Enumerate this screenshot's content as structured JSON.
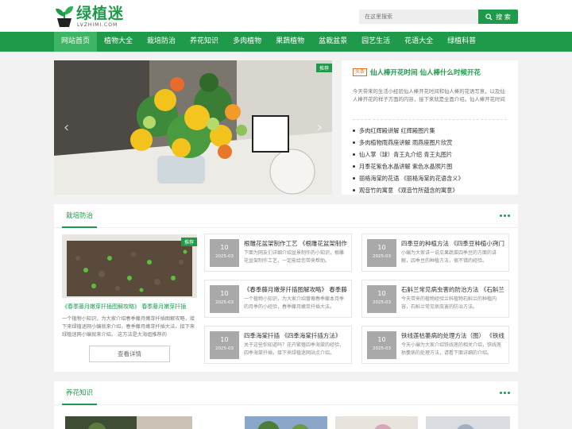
{
  "header": {
    "logo_text": "绿植迷",
    "logo_url": "LVZHIMI.COM",
    "search_placeholder": "在这里搜索",
    "search_button": "搜 索"
  },
  "nav": {
    "items": [
      "网站首页",
      "植物大全",
      "栽培防治",
      "养花知识",
      "多肉植物",
      "果蔬植物",
      "盆栽盆景",
      "园艺生活",
      "花语大全",
      "绿植科普"
    ]
  },
  "banner": {
    "tag": "推荐"
  },
  "headline": {
    "tag": "头条",
    "title": "仙人棒开花时间 仙人棒什么时候开花",
    "desc": "今天带来的生活小经验仙人棒开花时间和仙人棒的花语写意，以及仙人棒开花的样子方面的内容，接下来就是全面介绍。仙人棒开花时间",
    "list": [
      "多肉红辉殿讲解 红辉殿图片集",
      "多肉植物雨燕座讲解 雨燕座图片欣赏",
      "仙人掌（球）青王丸介绍 青王丸图片",
      "月季花紫色水晶讲解 紫色水晶照片图",
      "丽格海棠的花语 《丽格海棠的花语含义》",
      "观音竹的寓意 《观音竹所蕴含的寓意》"
    ]
  },
  "section1": {
    "title": "栽培防治",
    "feature": {
      "tag": "推荐",
      "title": "《春季藤月嫩芽扦插图解攻略》 春季藤月嫩芽扦插",
      "desc": "一个植物小知识，为大家介绍春季藤月嫩芽扦插图解攻略，接下来绿植迷网小编就来介绍，春季藤月嫩芽扦插大法，接下来绿植迷网小编就来介绍。 这方法是大海姐推荐的",
      "more": "查看详情"
    },
    "cards": [
      {
        "day": "10",
        "ym": "2025-03",
        "title": "根雕花盆架制作工艺 《根雕花盆架制作工艺》",
        "desc": "下面为网友们详细介绍盆景制作的小知识，根雕花盆架制作工艺，一定能给您带来帮助。"
      },
      {
        "day": "10",
        "ym": "2025-03",
        "title": "四季豆的种植方法 《四季豆种植小窍门》",
        "desc": "小编为大家讲一说瓜果蔬菜四季豆的方面的讲解，四季豆的种植方法，很不错的经验。"
      },
      {
        "day": "10",
        "ym": "2025-03",
        "title": "《春季藤月嫩芽扦插图解攻略》 春季藤月嫩芽扦插",
        "desc": "一个植物小知识，为大家介绍蔷薇春季藤本月季的月季的小经验，春季藤月嫩芽扦插大法。"
      },
      {
        "day": "10",
        "ym": "2025-03",
        "title": "石斛兰常见病虫害的防治方法 《石斛兰病虫害》",
        "desc": "今天带来的植物经验兰科植物石斛兰的种植内容，石斛兰常见病虫害的防治方法。"
      },
      {
        "day": "10",
        "ym": "2025-03",
        "title": "四季海棠扦插 《四季海棠扦插方法》",
        "desc": "关于这些你知道吗？花卉繁殖四季海棠的经验，四季海棠扦插，接下来绿植迷网站点介绍。"
      },
      {
        "day": "10",
        "ym": "2025-03",
        "title": "铁线莲枯萎病的处理方法（图） 《铁线莲》",
        "desc": "今天小编为大家介绍铁线莲的相关介绍，铁线莲枯萎病的处理方法，请看下面详细的介绍。"
      }
    ]
  },
  "section2": {
    "title": "养花知识"
  }
}
